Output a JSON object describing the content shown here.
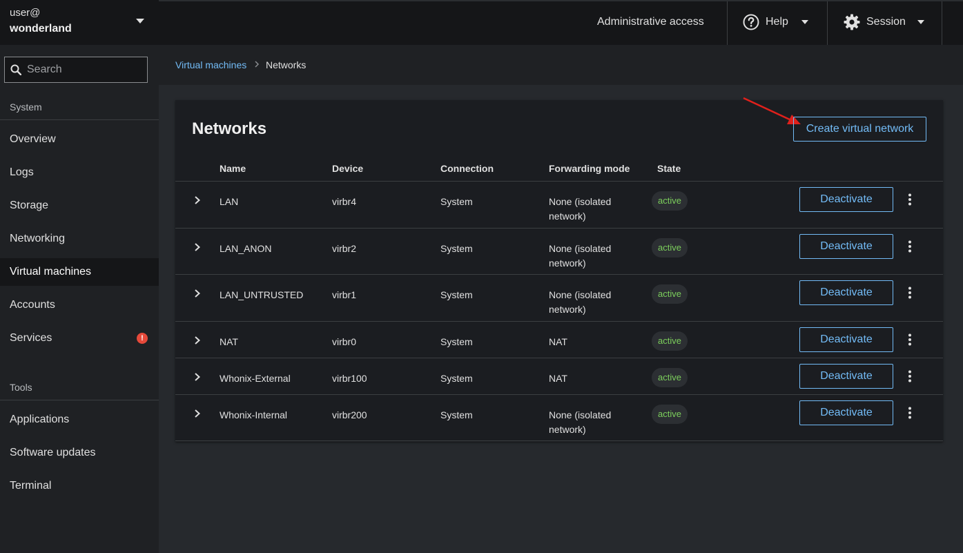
{
  "host": {
    "user": "user@",
    "name": "wonderland"
  },
  "search": {
    "placeholder": "Search"
  },
  "nav": {
    "system_title": "System",
    "system_items": [
      {
        "label": "Overview"
      },
      {
        "label": "Logs"
      },
      {
        "label": "Storage"
      },
      {
        "label": "Networking"
      },
      {
        "label": "Virtual machines",
        "active": true
      },
      {
        "label": "Accounts"
      },
      {
        "label": "Services",
        "badge": "!"
      }
    ],
    "tools_title": "Tools",
    "tools_items": [
      {
        "label": "Applications"
      },
      {
        "label": "Software updates"
      },
      {
        "label": "Terminal"
      }
    ]
  },
  "topbar": {
    "admin": "Administrative access",
    "help": "Help",
    "session": "Session",
    "help_icon": "question-circle-icon",
    "session_icon": "gear-icon"
  },
  "breadcrumb": {
    "parent": "Virtual machines",
    "current": "Networks"
  },
  "networks": {
    "title": "Networks",
    "create_label": "Create virtual network",
    "columns": [
      "Name",
      "Device",
      "Connection",
      "Forwarding mode",
      "State"
    ],
    "rows": [
      {
        "name": "LAN",
        "device": "virbr4",
        "connection": "System",
        "forwarding": [
          "None (isolated",
          "network)"
        ],
        "state": "active",
        "action": "Deactivate"
      },
      {
        "name": "LAN_ANON",
        "device": "virbr2",
        "connection": "System",
        "forwarding": [
          "None (isolated",
          "network)"
        ],
        "state": "active",
        "action": "Deactivate"
      },
      {
        "name": "LAN_UNTRUSTED",
        "device": "virbr1",
        "connection": "System",
        "forwarding": [
          "None (isolated",
          "network)"
        ],
        "state": "active",
        "action": "Deactivate"
      },
      {
        "name": "NAT",
        "device": "virbr0",
        "connection": "System",
        "forwarding": [
          "NAT",
          ""
        ],
        "state": "active",
        "action": "Deactivate"
      },
      {
        "name": "Whonix-External",
        "device": "virbr100",
        "connection": "System",
        "forwarding": [
          "NAT",
          ""
        ],
        "state": "active",
        "action": "Deactivate"
      },
      {
        "name": "Whonix-Internal",
        "device": "virbr200",
        "connection": "System",
        "forwarding": [
          "None (isolated",
          "network)"
        ],
        "state": "active",
        "action": "Deactivate"
      }
    ]
  },
  "colors": {
    "link": "#73bcf7",
    "active_state": "#7ccf5c",
    "annotation_arrow": "#e0201b",
    "badge_danger": "#e5493a"
  }
}
